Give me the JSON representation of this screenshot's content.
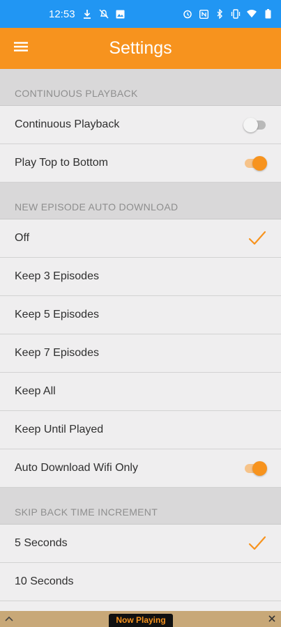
{
  "status_bar": {
    "time": "12:53",
    "left_icons": [
      "download-icon",
      "notifications-off-icon",
      "image-icon"
    ],
    "right_icons": [
      "alarm-icon",
      "nfc-icon",
      "bluetooth-icon",
      "vibrate-icon",
      "wifi-icon",
      "battery-icon"
    ]
  },
  "app_bar": {
    "title": "Settings",
    "menu_icon": "hamburger-menu-icon",
    "color": "#f7931e"
  },
  "sections": [
    {
      "header": "CONTINUOUS PLAYBACK",
      "rows": [
        {
          "label": "Continuous Playback",
          "control": "toggle",
          "on": false
        },
        {
          "label": "Play Top to Bottom",
          "control": "toggle",
          "on": true
        }
      ]
    },
    {
      "header": "NEW EPISODE AUTO DOWNLOAD",
      "rows": [
        {
          "label": "Off",
          "control": "check",
          "selected": true
        },
        {
          "label": "Keep 3 Episodes",
          "control": "check",
          "selected": false
        },
        {
          "label": "Keep 5 Episodes",
          "control": "check",
          "selected": false
        },
        {
          "label": "Keep 7 Episodes",
          "control": "check",
          "selected": false
        },
        {
          "label": "Keep All",
          "control": "check",
          "selected": false
        },
        {
          "label": "Keep Until Played",
          "control": "check",
          "selected": false
        },
        {
          "label": "Auto Download Wifi Only",
          "control": "toggle",
          "on": true
        }
      ]
    },
    {
      "header": "SKIP BACK TIME INCREMENT",
      "rows": [
        {
          "label": "5 Seconds",
          "control": "check",
          "selected": true
        },
        {
          "label": "10 Seconds",
          "control": "check",
          "selected": false
        }
      ]
    }
  ],
  "now_playing": {
    "label": "Now Playing"
  }
}
